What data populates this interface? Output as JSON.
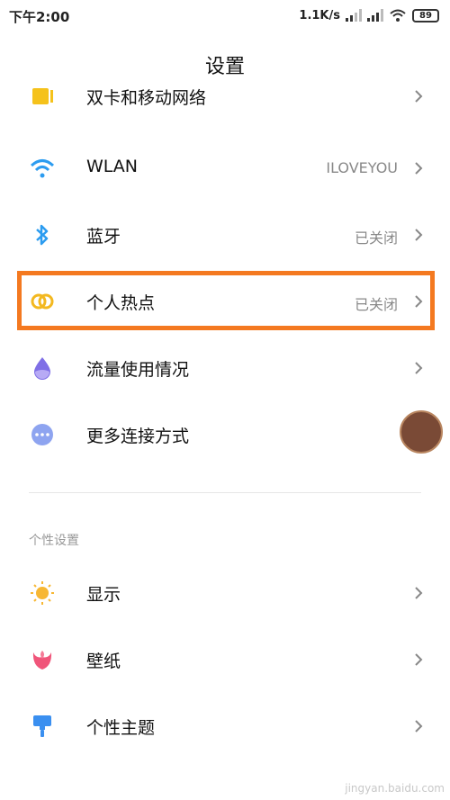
{
  "status_bar": {
    "time": "下午2:00",
    "speed": "1.1K/s",
    "battery": "89"
  },
  "header": {
    "title": "设置"
  },
  "rows": [
    {
      "label": "双卡和移动网络",
      "value": ""
    },
    {
      "label": "WLAN",
      "value": "ILOVEYOU"
    },
    {
      "label": "蓝牙",
      "value": "已关闭"
    },
    {
      "label": "个人热点",
      "value": "已关闭"
    },
    {
      "label": "流量使用情况",
      "value": ""
    },
    {
      "label": "更多连接方式",
      "value": ""
    }
  ],
  "section": {
    "title": "个性设置"
  },
  "personal_rows": [
    {
      "label": "显示"
    },
    {
      "label": "壁纸"
    },
    {
      "label": "个性主题"
    }
  ],
  "watermark": "jingyan.baidu.com",
  "colors": {
    "highlight": "#f47920",
    "wifi": "#2c9cf0",
    "bluetooth": "#2c9cf0",
    "hotspot": "#f3b820",
    "data": "#7f6fe6",
    "more": "#8ea4f0",
    "display": "#f7b733",
    "wallpaper": "#f0557a",
    "theme": "#3a8ff0"
  },
  "icons": {
    "sim": "sim-card-icon",
    "wifi": "wifi-icon",
    "bluetooth": "bluetooth-icon",
    "hotspot": "hotspot-icon",
    "data": "water-drop-icon",
    "more": "more-dots-icon",
    "display": "sun-icon",
    "wallpaper": "flower-icon",
    "theme": "brush-icon",
    "chevron": "chevron-right-icon"
  }
}
